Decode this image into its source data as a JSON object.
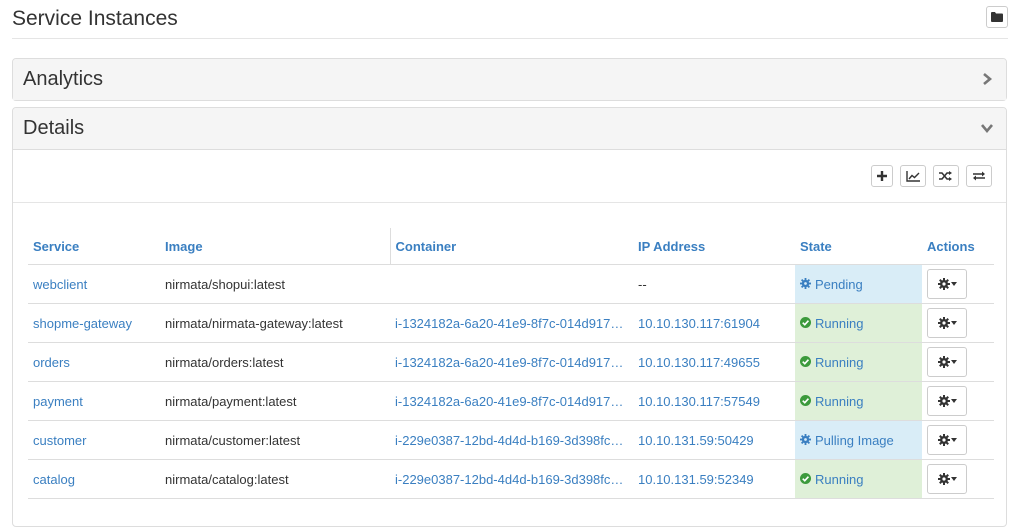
{
  "page": {
    "title": "Service Instances"
  },
  "panels": {
    "analytics": {
      "title": "Analytics"
    },
    "details": {
      "title": "Details"
    }
  },
  "table": {
    "headers": [
      "Service",
      "Image",
      "Container",
      "IP Address",
      "State",
      "Actions"
    ],
    "rows": [
      {
        "service": "webclient",
        "image": "nirmata/shopui:latest",
        "container": "",
        "ip": "--",
        "state": "Pending",
        "state_type": "pending"
      },
      {
        "service": "shopme-gateway",
        "image": "nirmata/nirmata-gateway:latest",
        "container": "i-1324182a-6a20-41e9-8f7c-014d917…",
        "ip": "10.10.130.117:61904",
        "state": "Running",
        "state_type": "running"
      },
      {
        "service": "orders",
        "image": "nirmata/orders:latest",
        "container": "i-1324182a-6a20-41e9-8f7c-014d917…",
        "ip": "10.10.130.117:49655",
        "state": "Running",
        "state_type": "running"
      },
      {
        "service": "payment",
        "image": "nirmata/payment:latest",
        "container": "i-1324182a-6a20-41e9-8f7c-014d917…",
        "ip": "10.10.130.117:57549",
        "state": "Running",
        "state_type": "running"
      },
      {
        "service": "customer",
        "image": "nirmata/customer:latest",
        "container": "i-229e0387-12bd-4d4d-b169-3d398fc…",
        "ip": "10.10.131.59:50429",
        "state": "Pulling Image",
        "state_type": "pending"
      },
      {
        "service": "catalog",
        "image": "nirmata/catalog:latest",
        "container": "i-229e0387-12bd-4d4d-b169-3d398fc…",
        "ip": "10.10.131.59:52349",
        "state": "Running",
        "state_type": "running"
      }
    ]
  },
  "colors": {
    "link": "#3a7fc1",
    "running": "#3c9a3c",
    "pending": "#3a7fc1"
  },
  "icons": {
    "header": "folder-icon",
    "analytics": "chevron-right-icon",
    "details": "chevron-down-icon",
    "toolbar": [
      "plus-icon",
      "line-chart-icon",
      "shuffle-icon",
      "swap-icon"
    ]
  }
}
